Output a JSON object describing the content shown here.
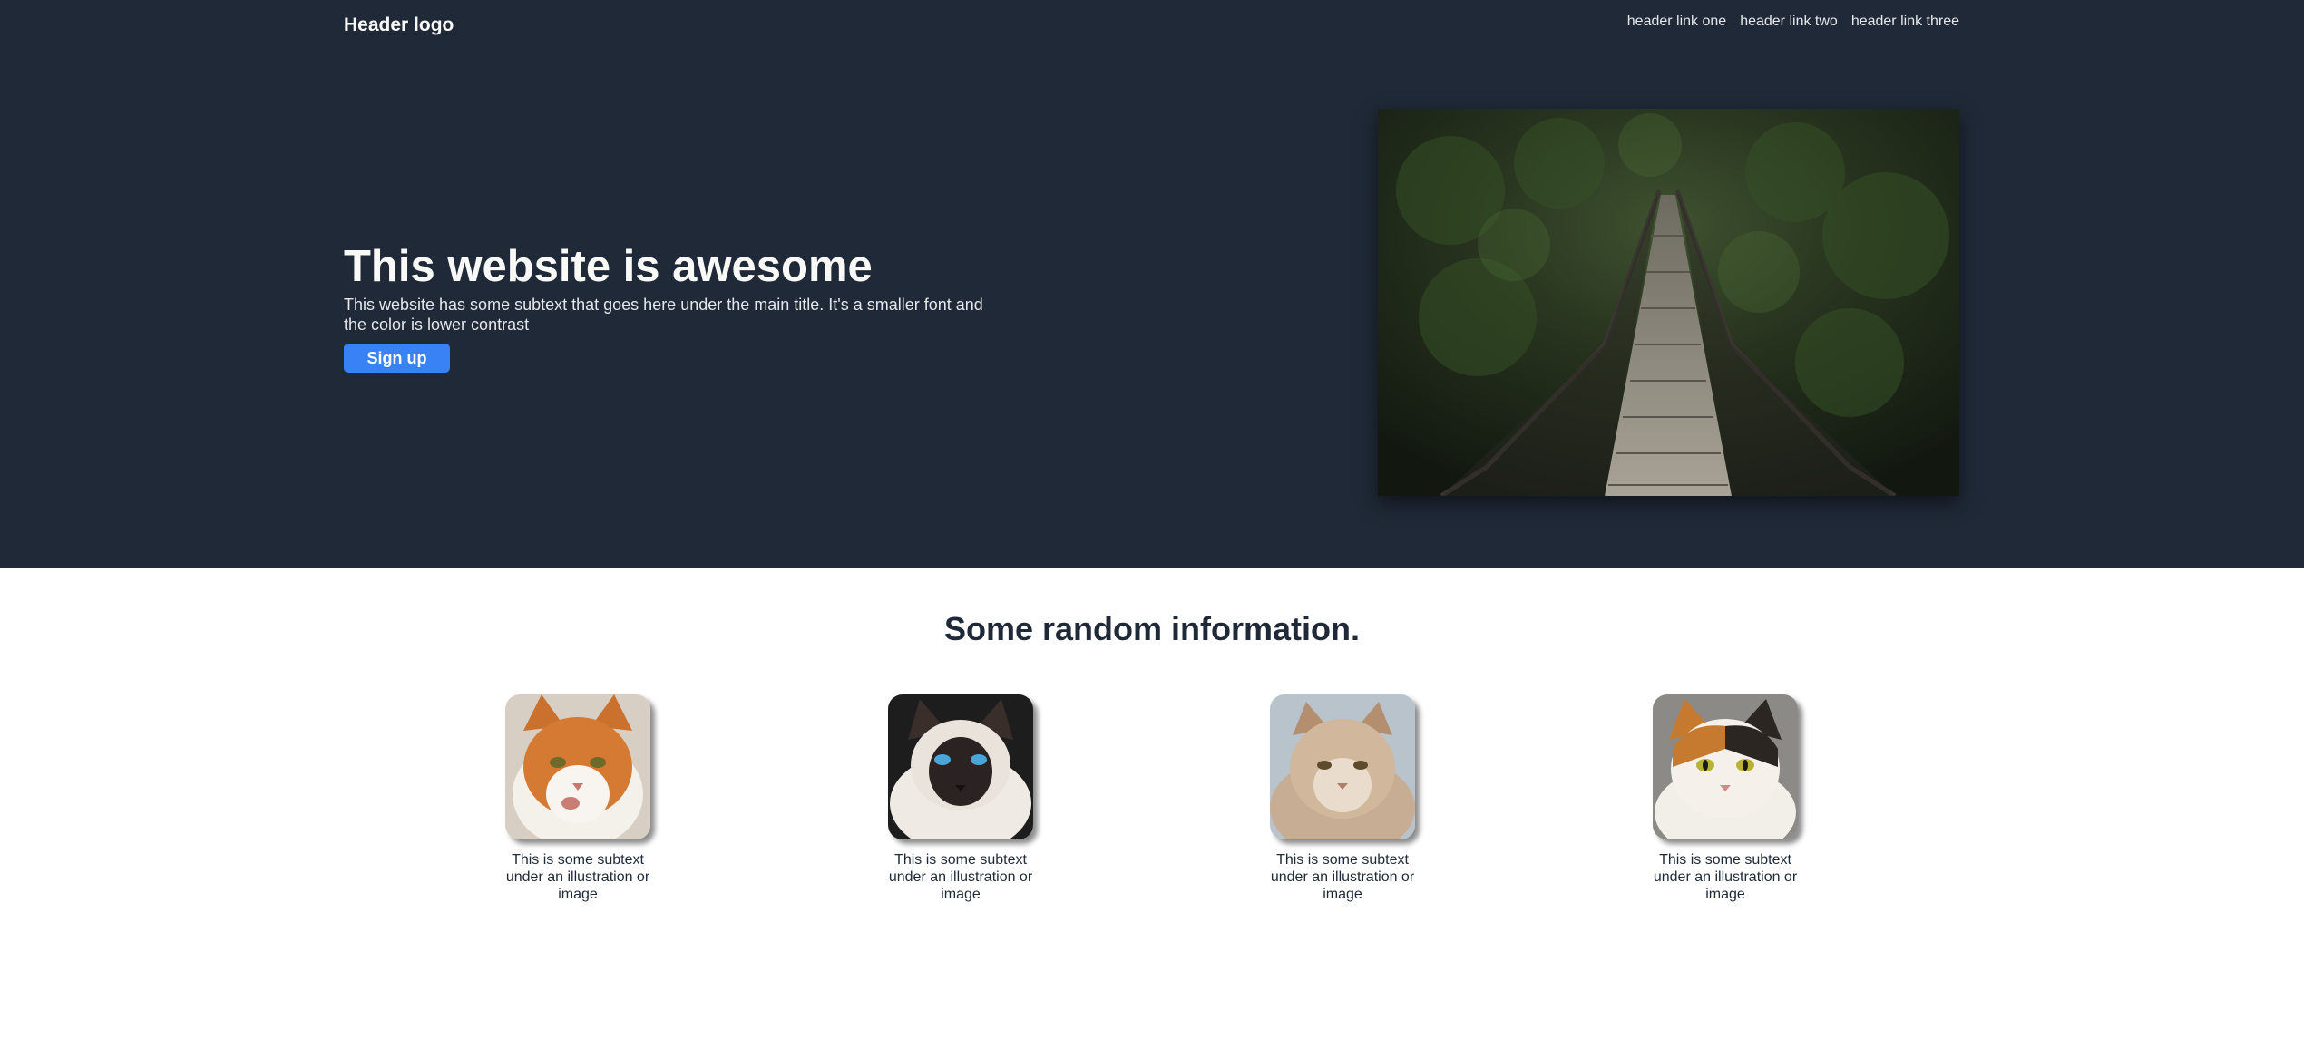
{
  "header": {
    "logo": "Header logo",
    "links": [
      "header link one",
      "header link two",
      "header link three"
    ]
  },
  "hero": {
    "title": "This website is awesome",
    "subtitle": "This website has some subtext that goes here under the main title. It's a smaller font and the color is lower contrast",
    "cta_label": "Sign up"
  },
  "info": {
    "title": "Some random information.",
    "cards": [
      {
        "text": "This is some subtext under an illustration or image"
      },
      {
        "text": "This is some subtext under an illustration or image"
      },
      {
        "text": "This is some subtext under an illustration or image"
      },
      {
        "text": "This is some subtext under an illustration or image"
      }
    ]
  },
  "colors": {
    "hero_bg": "#1f2937",
    "accent": "#3882f6",
    "title_text": "#f9faf8",
    "muted_text": "#e5e7eb"
  }
}
